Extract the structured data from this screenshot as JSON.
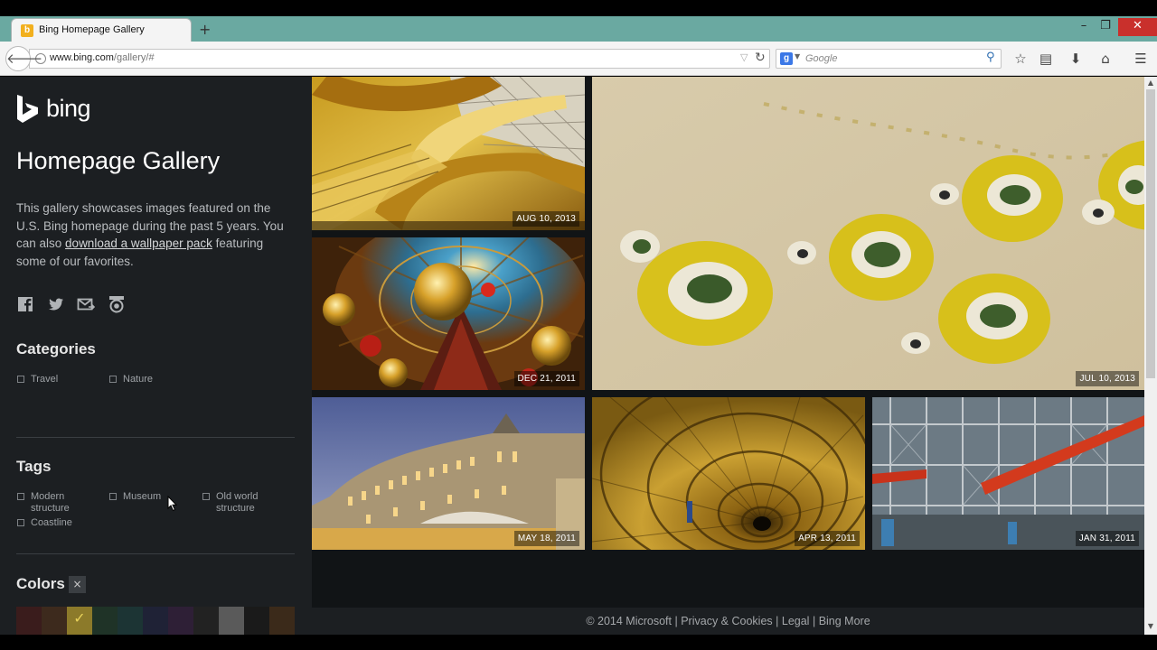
{
  "browser": {
    "tab_title": "Bing Homepage Gallery",
    "tab_favicon": "b",
    "new_tab_label": "+",
    "window_controls": {
      "minimize": "–",
      "maximize": "❐",
      "close": "✕"
    },
    "url_domain": "www.bing.com",
    "url_path": "/gallery/#",
    "search_engine_icon": "g",
    "search_placeholder": "Google",
    "toolbar_icons": [
      "star-icon",
      "reading-list-icon",
      "download-icon",
      "home-icon",
      "menu-icon"
    ]
  },
  "sidebar": {
    "logo_text": "bing",
    "title": "Homepage Gallery",
    "description_before": "This gallery showcases images featured on the U.S. Bing homepage during the past 5 years. You can also ",
    "description_link": "download a wallpaper pack",
    "description_after": " featuring some of our favorites.",
    "social_icons": [
      "facebook-icon",
      "twitter-icon",
      "email-icon",
      "rss-icon"
    ],
    "categories_title": "Categories",
    "categories": [
      "Travel",
      "Nature"
    ],
    "tags_title": "Tags",
    "tags": [
      "Modern structure",
      "Museum",
      "Old world structure",
      "Coastline"
    ],
    "colors_title": "Colors",
    "colors_clear": "×",
    "swatch_colors": [
      "#3a1c1c",
      "#3d2a1d",
      "#8c7a2a",
      "#1f3327",
      "#1c3434",
      "#1f2236",
      "#2e1f36",
      "#222222",
      "#5a5a5a",
      "#1a1a1a",
      "#3b2a1a"
    ]
  },
  "gallery": {
    "tiles": [
      {
        "date": "AUG 10, 2013",
        "subject": "golden-spiral-staircase"
      },
      {
        "date": "DEC 21, 2011",
        "subject": "christmas-dome"
      },
      {
        "date": "JUL 10, 2013",
        "subject": "desert-islands-aerial"
      },
      {
        "date": "MAY 18, 2011",
        "subject": "museum-building-night"
      },
      {
        "date": "APR 13, 2011",
        "subject": "spiral-staircase-down"
      },
      {
        "date": "JAN 31, 2011",
        "subject": "pompidou-facade"
      }
    ]
  },
  "footer": {
    "copyright": "© 2014 Microsoft",
    "sep": "|",
    "privacy": "Privacy & Cookies",
    "legal": "Legal",
    "bing_more": "Bing More"
  }
}
